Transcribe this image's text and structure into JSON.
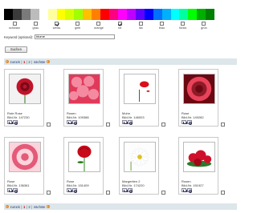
{
  "palette": [
    "#000000",
    "#3a3a3a",
    "#7a7a7a",
    "#bcbcbc",
    "#ffffff",
    "#ffffa0",
    "#ffff00",
    "#d8ff00",
    "#a0ff00",
    "#ffc000",
    "#ff8000",
    "#ff0000",
    "#ff0080",
    "#ff00ff",
    "#c000ff",
    "#6000ff",
    "#0000ff",
    "#0070ff",
    "#00b0ff",
    "#00ffff",
    "#00ffa0",
    "#00ff00",
    "#00b000",
    "#008000"
  ],
  "colors": [
    {
      "label": "schwarz",
      "checked": false
    },
    {
      "label": "grau",
      "checked": false
    },
    {
      "label": "weiss",
      "checked": true
    },
    {
      "label": "gelb",
      "checked": false
    },
    {
      "label": "orange",
      "checked": false
    },
    {
      "label": "rot",
      "checked": true
    },
    {
      "label": "lila",
      "checked": false
    },
    {
      "label": "blau",
      "checked": false
    },
    {
      "label": "türkis",
      "checked": false
    },
    {
      "label": "grün",
      "checked": false
    }
  ],
  "keyword": {
    "label": "Keyword (optional):",
    "value": "blume"
  },
  "search_button": "Suchen",
  "pager": {
    "prev": "zurück",
    "pages": [
      "1",
      "2"
    ],
    "current_page": "1",
    "next": "nächste"
  },
  "images": [
    {
      "title": "Rote Rose",
      "id": "Bild-Nr. 147230",
      "icon": "red-rose-image",
      "palette": [
        "#f2f2f2",
        "#c0142a",
        "#7a0a18"
      ]
    },
    {
      "title": "Rosen",
      "id": "Bild-Nr. 109388",
      "icon": "roses-bouquet-image",
      "palette": [
        "#8a0f1a",
        "#e03a5a",
        "#f48aa0"
      ]
    },
    {
      "title": "Mohn",
      "id": "Bild-Nr. 146003",
      "icon": "poppy-image",
      "palette": [
        "#ffffff",
        "#d8101a",
        "#2a6a1a"
      ]
    },
    {
      "title": "Rose",
      "id": "Bild-Nr. 149282",
      "icon": "rose-closeup-image",
      "palette": [
        "#b40f24",
        "#e8435a",
        "#6a0812"
      ]
    },
    {
      "title": "Rose",
      "id": "Bild-Nr. 136361",
      "icon": "pink-rose-image",
      "palette": [
        "#f3a0b0",
        "#e45a78",
        "#fbd4dc"
      ]
    },
    {
      "title": "Rose",
      "id": "Bild-Nr. 151409",
      "icon": "red-rose-stem-image",
      "palette": [
        "#ffffff",
        "#c80a1a",
        "#2a7a1a"
      ]
    },
    {
      "title": "Margeriten 2",
      "id": "Bild-Nr. 174220",
      "icon": "daisy-image",
      "palette": [
        "#ffffff",
        "#f0f0f0",
        "#e0c020"
      ]
    },
    {
      "title": "Rosen",
      "id": "Bild-Nr. 151927",
      "icon": "roses-bunch-image",
      "palette": [
        "#ffffff",
        "#d0102a",
        "#2a7a2a"
      ]
    }
  ]
}
